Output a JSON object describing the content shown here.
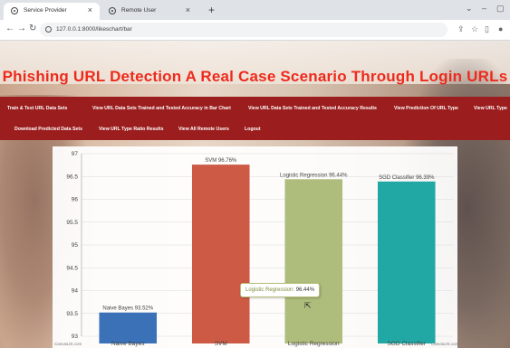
{
  "browser": {
    "tabs": [
      {
        "title": "Service Provider",
        "active": true
      },
      {
        "title": "Remote User",
        "active": false
      }
    ],
    "new_tab": "+",
    "url": "127.0.0.1:8000/likeschart/bar"
  },
  "page": {
    "title": "Phishing URL Detection A Real Case Scenario Through Login URLs",
    "menu_row1": [
      "Train & Test URL Data Sets",
      "View URL Data Sets Trained and Tested Accuracy in Bar Chart",
      "View URL Data Sets Trained and Tested Accuracy Results",
      "View Prediction Of URL Type",
      "View URL Type"
    ],
    "menu_row2": [
      "Download Predicted Data Sets",
      "View URL Type Ratio Results",
      "View All Remote Users",
      "Logout"
    ]
  },
  "chart_data": {
    "type": "bar",
    "categories": [
      "Naive Bayes",
      "SVM",
      "Logistic Regression",
      "SGD Classifier"
    ],
    "values": [
      93.52,
      96.76,
      96.44,
      96.39
    ],
    "data_labels": [
      "Naive Bayes 93.52%",
      "SVM 96.76%",
      "Logistic Regression 96.44%",
      "SGD Classifier 96.39%"
    ],
    "colors": [
      "#3b71b7",
      "#cc5a45",
      "#aebc7c",
      "#21a8a5"
    ],
    "yticks": [
      "97",
      "96.5",
      "96",
      "95.5",
      "95",
      "94.5",
      "94",
      "93.5",
      "93"
    ],
    "ylim": [
      93,
      97
    ],
    "grid": true,
    "credit_left": "CanvasJS.com",
    "credit_right": "CanvasJS.com",
    "tooltip": {
      "label": "Logistic Regression:",
      "value": "96.44%"
    }
  }
}
